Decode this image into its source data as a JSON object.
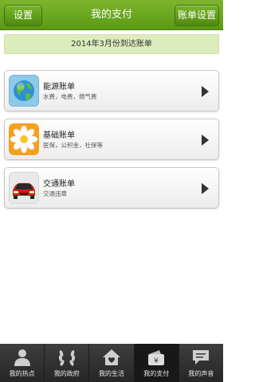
{
  "header": {
    "left_button": "设置",
    "title": "我的支付",
    "right_button": "账单设置"
  },
  "banner": "2014年3月份到达账单",
  "cards": [
    {
      "title": "能源账单",
      "subtitle": "水费，电费，燃气费",
      "icon": "globe-icon"
    },
    {
      "title": "基础账单",
      "subtitle": "医保，公积金，社保等",
      "icon": "flower-icon"
    },
    {
      "title": "交通账单",
      "subtitle": "交通违章",
      "icon": "car-icon"
    }
  ],
  "nav": [
    {
      "label": "我的热点",
      "icon": "person-icon"
    },
    {
      "label": "我的政府",
      "icon": "laurel-icon"
    },
    {
      "label": "我的生活",
      "icon": "house-icon"
    },
    {
      "label": "我的支付",
      "icon": "wallet-icon",
      "active": true
    },
    {
      "label": "我的声音",
      "icon": "chat-icon"
    }
  ]
}
